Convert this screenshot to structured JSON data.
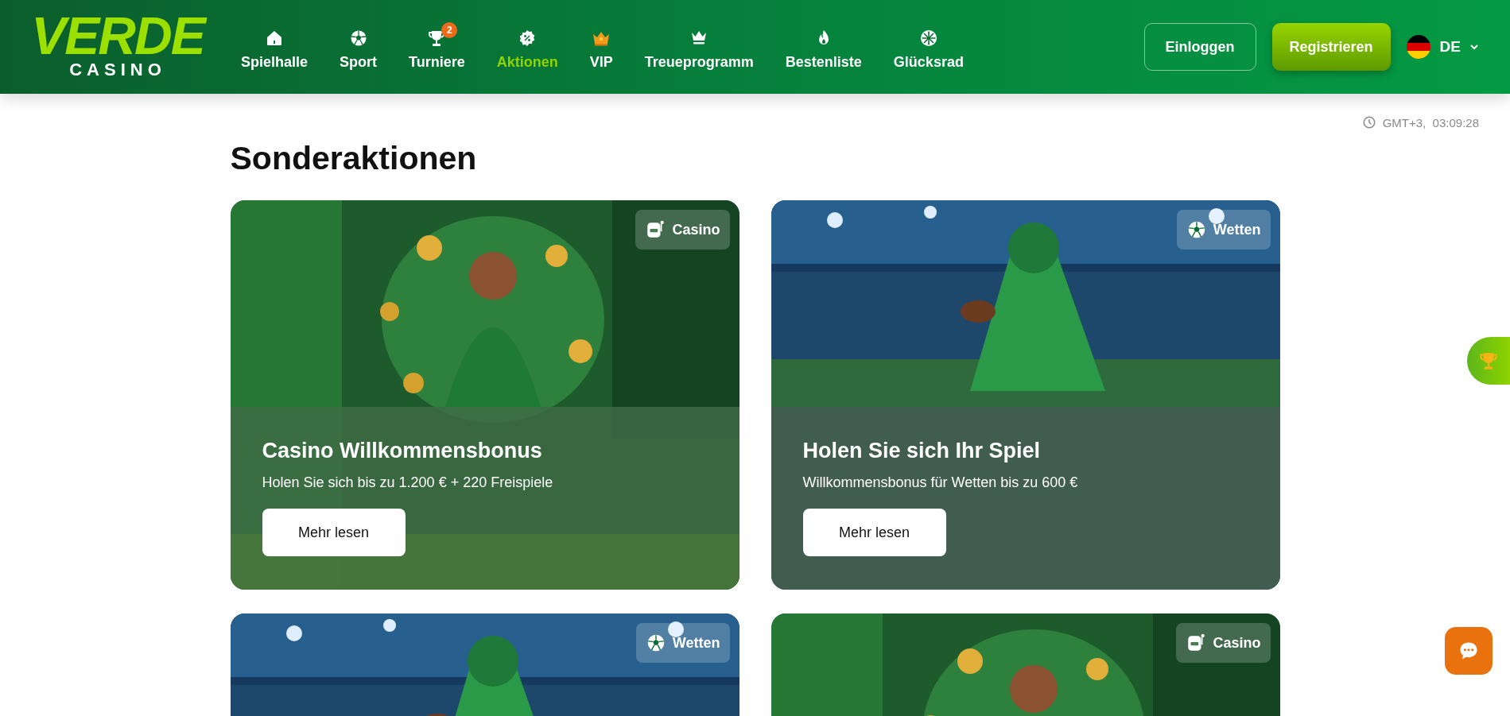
{
  "header": {
    "logo": {
      "word": "VERDE",
      "sub": "CASINO"
    },
    "nav": [
      {
        "label": "Spielhalle",
        "selected": false
      },
      {
        "label": "Sport",
        "selected": false
      },
      {
        "label": "Turniere",
        "selected": false,
        "badge": "2"
      },
      {
        "label": "Aktionen",
        "selected": true
      },
      {
        "label": "VIP",
        "selected": false
      },
      {
        "label": "Treueprogramm",
        "selected": false
      },
      {
        "label": "Bestenliste",
        "selected": false
      },
      {
        "label": "Glücksrad",
        "selected": false
      }
    ],
    "login": "Einloggen",
    "register": "Registrieren",
    "language": "DE"
  },
  "clock": {
    "zone": "GMT+3,",
    "time": "03:09:28"
  },
  "title": "Sonderaktionen",
  "promos": [
    {
      "tag": {
        "kind": "casino",
        "label": "Casino"
      },
      "title": "Casino Willkommensbonus",
      "subtitle": "Holen Sie sich bis zu 1.200 € + 220 Freispiele",
      "button": "Mehr lesen"
    },
    {
      "tag": {
        "kind": "sport",
        "label": "Wetten"
      },
      "title": "Holen Sie sich Ihr Spiel",
      "subtitle": "Willkommensbonus für Wetten bis zu 600 €",
      "button": "Mehr lesen"
    },
    {
      "tag": {
        "kind": "sport",
        "label": "Wetten"
      }
    },
    {
      "tag": {
        "kind": "casino",
        "label": "Casino"
      }
    }
  ]
}
